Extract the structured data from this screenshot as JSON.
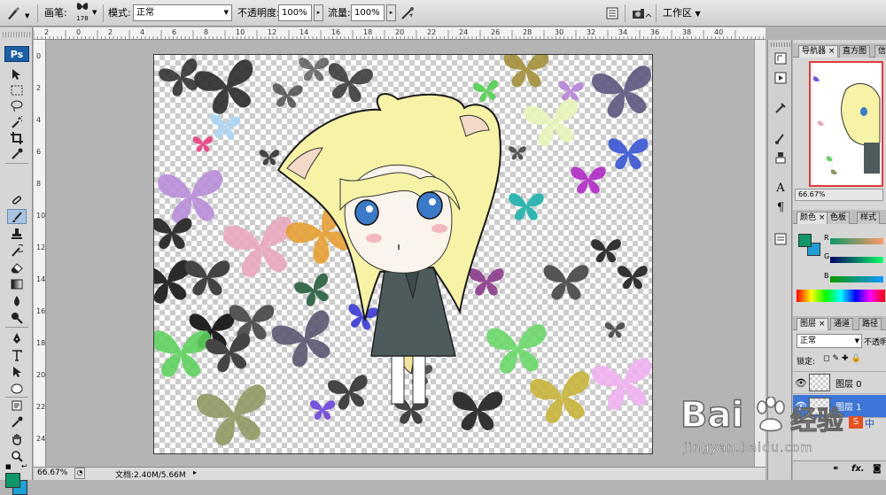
{
  "options_bar": {
    "brush_label": "画笔:",
    "brush_size": "178",
    "mode_label": "模式:",
    "mode_value": "正常",
    "opacity_label": "不透明度:",
    "opacity_value": "100%",
    "flow_label": "流量:",
    "flow_value": "100%",
    "workspace_label": "工作区"
  },
  "toolbox": {
    "logo": "Ps",
    "tools": [
      "move",
      "marquee",
      "lasso",
      "magic-wand",
      "crop",
      "eyedropper",
      "healing",
      "brush",
      "clone-stamp",
      "history-brush",
      "eraser",
      "gradient",
      "blur",
      "dodge",
      "pen",
      "type",
      "path-select",
      "shape",
      "notes",
      "eyedropper-2",
      "hand",
      "zoom"
    ],
    "active_tool": "brush",
    "foreground_color": "#0e9867",
    "background_color": "#1c9fd6"
  },
  "ruler": {
    "top_marks": [
      "2",
      "0",
      "2",
      "4",
      "6",
      "8",
      "10",
      "12",
      "14",
      "16",
      "18",
      "20",
      "22",
      "24",
      "26",
      "28",
      "30",
      "32",
      "34",
      "36",
      "38",
      "40"
    ],
    "left_marks": [
      "0",
      "2",
      "4",
      "6",
      "8",
      "10",
      "12",
      "14",
      "16",
      "18",
      "20",
      "22",
      "24"
    ]
  },
  "status_bar": {
    "zoom": "66.67%",
    "doc_info": "文档:2.40M/5.66M"
  },
  "panels": {
    "navigator_tabs": [
      "导航器",
      "直方图",
      "信"
    ],
    "navigator_zoom": "66.67%",
    "color_tabs": [
      "颜色",
      "色板",
      "样式"
    ],
    "color_channels": [
      "R",
      "G",
      "B"
    ],
    "layers_tabs": [
      "图层",
      "通道",
      "路径"
    ],
    "blend_mode": "正常",
    "opacity_short": "不透明",
    "lock_label": "锁定:",
    "layers": [
      {
        "name": "图层 0",
        "selected": false
      },
      {
        "name": "图层 1",
        "selected": true
      }
    ],
    "fx_label": "fx."
  },
  "watermark": {
    "brand": "Bai",
    "brand_suffix": "经验",
    "url": "jingyan.baidu.com",
    "ime_label": "中"
  }
}
